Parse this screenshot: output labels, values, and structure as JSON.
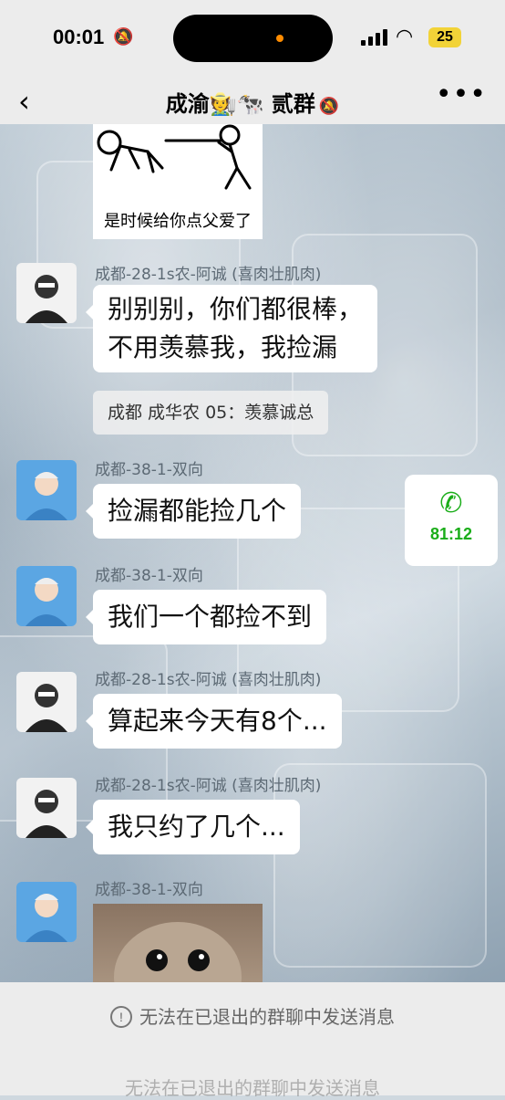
{
  "status_bar": {
    "time": "00:01",
    "battery": "25"
  },
  "nav": {
    "back": "‹",
    "title": "成渝🧑‍🌾🐄 贰群",
    "mute_icon": "🔕",
    "more": "•••"
  },
  "sticker_top": {
    "caption": "是时候给你点父爱了"
  },
  "messages": [
    {
      "sender": "成都-28-1s农-阿诚 (喜肉壮肌肉)",
      "text_line1": "别别别，你们都很棒，",
      "text_line2": "不用羡慕我，我捡漏"
    },
    {
      "quote": "成都 成华农 05：羡慕诚总"
    },
    {
      "sender": "成都-38-1-双向",
      "text": "捡漏都能捡几个"
    },
    {
      "sender": "成都-38-1-双向",
      "text": "我们一个都捡不到"
    },
    {
      "sender": "成都-28-1s农-阿诚 (喜肉壮肌肉)",
      "text": "算起来今天有8个..."
    },
    {
      "sender": "成都-28-1s农-阿诚 (喜肉壮肌肉)",
      "text": "我只约了几个..."
    },
    {
      "sender": "成都-38-1-双向"
    }
  ],
  "call_card": {
    "duration": "81:12"
  },
  "bottom": {
    "notice": "无法在已退出的群聊中发送消息"
  }
}
